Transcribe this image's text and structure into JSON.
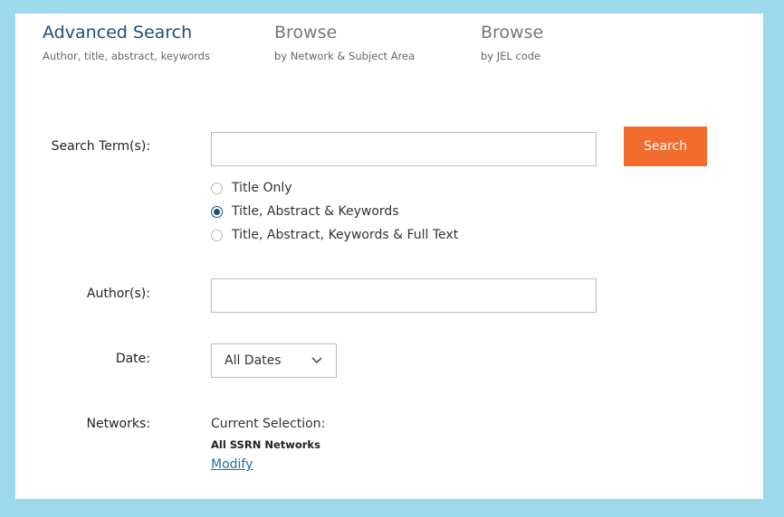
{
  "tabs": [
    {
      "title": "Advanced Search",
      "subtitle": "Author, title, abstract, keywords",
      "active": true
    },
    {
      "title": "Browse",
      "subtitle": "by Network & Subject Area",
      "active": false
    },
    {
      "title": "Browse",
      "subtitle": "by JEL code",
      "active": false
    }
  ],
  "form": {
    "search_label": "Search Term(s):",
    "search_value": "",
    "search_button": "Search",
    "scope_options": [
      {
        "label": "Title Only",
        "checked": false
      },
      {
        "label": "Title, Abstract & Keywords",
        "checked": true
      },
      {
        "label": "Title, Abstract, Keywords & Full Text",
        "checked": false
      }
    ],
    "author_label": "Author(s):",
    "author_value": "",
    "date_label": "Date:",
    "date_value": "All Dates",
    "networks_label": "Networks:",
    "current_selection_label": "Current Selection:",
    "current_selection_value": "All SSRN Networks",
    "modify_link": "Modify"
  },
  "colors": {
    "background": "#9dd9ea",
    "accent": "#f26b2f",
    "active_tab": "#1e4f7c",
    "link": "#1f6fa8"
  },
  "icons": {
    "date_dropdown": "chevron-down-icon"
  }
}
